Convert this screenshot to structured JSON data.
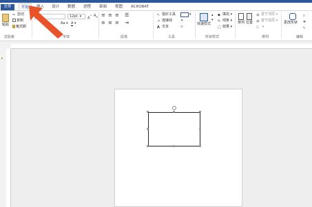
{
  "tabs": [
    {
      "label": "文件",
      "active": false
    },
    {
      "label": "开始",
      "active": true
    },
    {
      "label": "插入",
      "active": false
    },
    {
      "label": "设计",
      "active": false
    },
    {
      "label": "数据",
      "active": false
    },
    {
      "label": "进程",
      "active": false
    },
    {
      "label": "审阅",
      "active": false
    },
    {
      "label": "视图",
      "active": false
    },
    {
      "label": "ACROBAT",
      "active": false
    }
  ],
  "clipboard": {
    "paste": "粘贴",
    "cut": "剪切",
    "copy": "复制",
    "format_painter": "格式刷",
    "group_label": "剪贴板"
  },
  "font": {
    "size": "12pt.",
    "group_label": "字体"
  },
  "paragraph": {
    "group_label": "段落"
  },
  "tools": {
    "pointer": "指针工具",
    "connector": "连接线",
    "text": "文本",
    "group_label": "工具"
  },
  "shape_styles": {
    "quick_styles": "快速样式",
    "fill": "填充",
    "line": "线条",
    "effects": "效果",
    "group_label": "形状样式"
  },
  "arrange": {
    "arrange_btn": "排列",
    "position_btn": "位置",
    "bring_front": "置于顶层",
    "send_back": "置于底层",
    "group_label": "排列"
  },
  "editing": {
    "change_shape": "更改形状",
    "group_label": "编辑"
  },
  "colors": {
    "brand": "#2b579a",
    "arrow": "#e8532a"
  }
}
